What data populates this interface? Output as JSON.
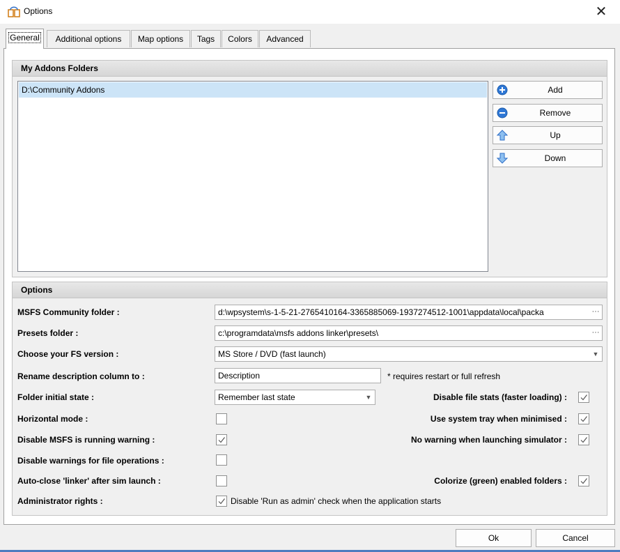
{
  "window": {
    "title": "Options",
    "close_glyph": "✕",
    "icon": "app-link-icon"
  },
  "tabs": [
    "General",
    "Additional options",
    "Map options",
    "Tags",
    "Colors",
    "Advanced"
  ],
  "addons": {
    "header": "My Addons Folders",
    "items": [
      "D:\\Community Addons"
    ],
    "buttons": {
      "add": "Add",
      "remove": "Remove",
      "up": "Up",
      "down": "Down"
    }
  },
  "options": {
    "header": "Options",
    "community_folder": {
      "label": "MSFS Community folder :",
      "value": "d:\\wpsystem\\s-1-5-21-2765410164-3365885069-1937274512-1001\\appdata\\local\\packa"
    },
    "presets_folder": {
      "label": "Presets folder :",
      "value": "c:\\programdata\\msfs addons linker\\presets\\"
    },
    "fs_version": {
      "label": "Choose your FS version :",
      "value": "MS Store / DVD (fast launch)"
    },
    "rename_desc": {
      "label": "Rename description column to :",
      "value": "Description",
      "note": "* requires restart or full refresh"
    },
    "folder_state": {
      "label": "Folder initial state :",
      "value": "Remember last state"
    },
    "disable_file_stats": {
      "label": "Disable file stats (faster loading) :",
      "checked": true
    },
    "horizontal_mode": {
      "label": "Horizontal mode :",
      "checked": false
    },
    "system_tray": {
      "label": "Use system tray when minimised :",
      "checked": true
    },
    "disable_running_warning": {
      "label": "Disable MSFS is running warning :",
      "checked": true
    },
    "no_launch_warning": {
      "label": "No warning when launching simulator :",
      "checked": true
    },
    "disable_file_warnings": {
      "label": "Disable warnings for file operations :",
      "checked": false
    },
    "auto_close": {
      "label": "Auto-close 'linker' after sim launch :",
      "checked": false
    },
    "colorize": {
      "label": "Colorize (green) enabled folders :",
      "checked": true
    },
    "admin_rights": {
      "label": "Administrator rights :",
      "checked": true,
      "check_label": "Disable 'Run as admin' check when the application starts"
    }
  },
  "footer": {
    "ok": "Ok",
    "cancel": "Cancel"
  },
  "colors": {
    "selection": "#cce4f7",
    "accent": "#4f7cbf",
    "add_icon": "#2f78d6"
  }
}
